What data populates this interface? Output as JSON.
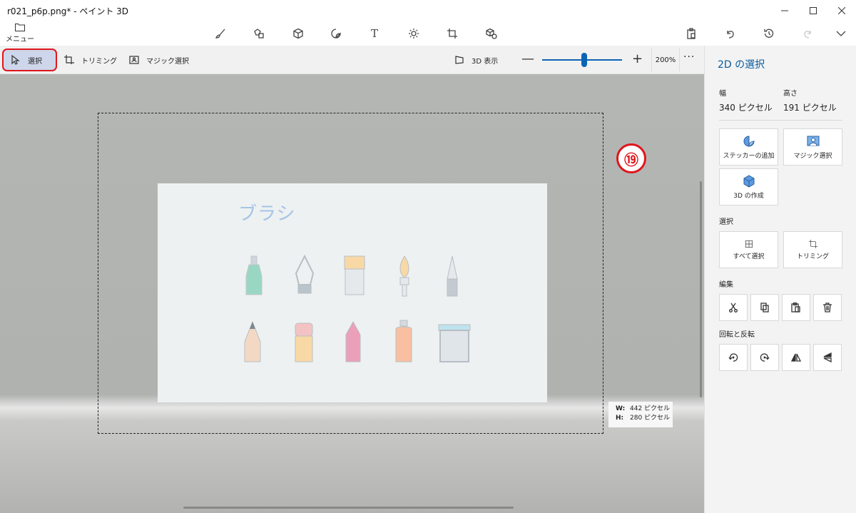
{
  "window": {
    "title": "r021_p6p.png* - ペイント 3D"
  },
  "topbar": {
    "menu_label": "メニュー",
    "tools": [
      "brushes-icon",
      "2d-shapes-icon",
      "3d-shapes-icon",
      "stickers-icon",
      "text-icon",
      "effects-icon",
      "canvas-icon",
      "3d-library-icon"
    ],
    "text_tool_glyph": "T"
  },
  "subbar": {
    "select_label": "選択",
    "crop_label": "トリミング",
    "magic_select_label": "マジック選択",
    "view3d_label": "3D 表示",
    "zoom_minus": "—",
    "zoom_plus": "+",
    "zoom_level": "200%",
    "zoom_fraction": 0.5,
    "more": "···"
  },
  "canvas": {
    "image_title": "ブラシ",
    "step_badge": "⑲",
    "dims": {
      "w_label": "W:",
      "w_value": "442 ピクセル",
      "h_label": "H:",
      "h_value": "280 ピクセル"
    }
  },
  "panel": {
    "title": "2D の選択",
    "width_label": "幅",
    "width_value": "340 ピクセル",
    "height_label": "高さ",
    "height_value": "191 ピクセル",
    "add_sticker": "ステッカーの追加",
    "magic_select": "マジック選択",
    "make_3d": "3D の作成",
    "select_section": "選択",
    "select_all": "すべて選択",
    "crop": "トリミング",
    "edit_section": "編集",
    "rotate_section": "回転と反転"
  },
  "colors": {
    "accent": "#0a64b5",
    "highlight_border": "#e0161c",
    "select_bg": "#cdd6ea",
    "canvas_bg": "#b2b3b1",
    "picture_title": "#a6c4e6"
  }
}
